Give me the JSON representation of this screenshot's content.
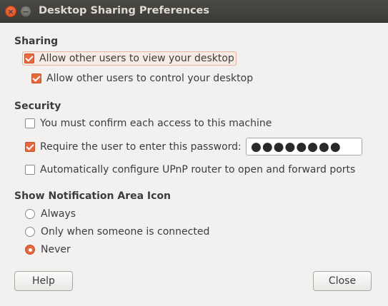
{
  "window": {
    "title": "Desktop Sharing Preferences",
    "close_glyph": "×",
    "minimize_glyph": "−"
  },
  "sharing": {
    "header": "Sharing",
    "allow_view": {
      "label": "Allow other users to view your desktop",
      "checked": true
    },
    "allow_control": {
      "label": "Allow other users to control your desktop",
      "checked": true
    }
  },
  "security": {
    "header": "Security",
    "confirm_access": {
      "label": "You must confirm each access to this machine",
      "checked": false
    },
    "require_password": {
      "label": "Require the user to enter this password:",
      "checked": true
    },
    "password_value": "●●●●●●●●",
    "upnp": {
      "label": "Automatically configure UPnP router to open and forward ports",
      "checked": false
    }
  },
  "notification": {
    "header": "Show Notification Area Icon",
    "options": [
      {
        "label": "Always",
        "selected": false
      },
      {
        "label": "Only when someone is connected",
        "selected": false
      },
      {
        "label": "Never",
        "selected": true
      }
    ]
  },
  "buttons": {
    "help": "Help",
    "close": "Close"
  },
  "colors": {
    "accent": "#e6683c",
    "titlebar": "#3c3b37",
    "background": "#f2f1f0"
  }
}
